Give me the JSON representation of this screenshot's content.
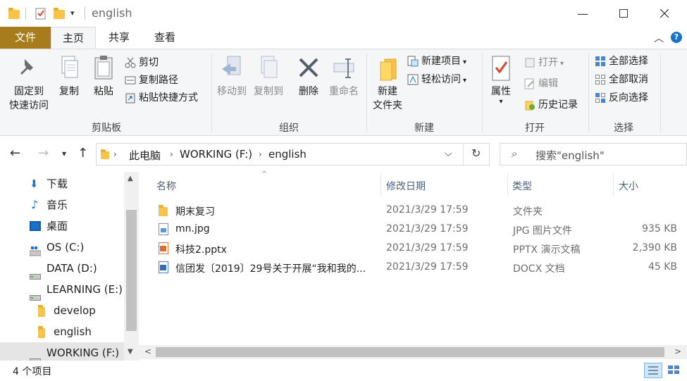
{
  "window": {
    "title": "english"
  },
  "tabs": {
    "file": "文件",
    "home": "主页",
    "share": "共享",
    "view": "查看"
  },
  "ribbon": {
    "clipboard": {
      "label": "剪贴板",
      "pin_line1": "固定到",
      "pin_line2": "快速访问",
      "copy": "复制",
      "paste": "粘贴",
      "cut": "剪切",
      "copy_path": "复制路径",
      "paste_shortcut": "粘贴快捷方式"
    },
    "organize": {
      "label": "组织",
      "move_to": "移动到",
      "copy_to": "复制到",
      "delete": "删除",
      "rename": "重命名"
    },
    "new": {
      "label": "新建",
      "new_folder_line1": "新建",
      "new_folder_line2": "文件夹",
      "new_item": "新建项目",
      "easy_access": "轻松访问"
    },
    "open": {
      "label": "打开",
      "properties": "属性",
      "open": "打开",
      "edit": "编辑",
      "history": "历史记录"
    },
    "select": {
      "label": "选择",
      "select_all": "全部选择",
      "select_none": "全部取消",
      "invert": "反向选择"
    }
  },
  "address": {
    "crumbs": [
      "此电脑",
      "WORKING (F:)",
      "english"
    ],
    "search_placeholder": "搜索\"english\""
  },
  "nav": {
    "items": [
      {
        "label": "下载",
        "icon": "download-icon"
      },
      {
        "label": "音乐",
        "icon": "music-icon"
      },
      {
        "label": "桌面",
        "icon": "desktop-icon"
      },
      {
        "label": "OS (C:)",
        "icon": "windows-drive-icon"
      },
      {
        "label": "DATA (D:)",
        "icon": "drive-icon"
      },
      {
        "label": "LEARNING (E:)",
        "icon": "drive-icon"
      },
      {
        "label": "develop",
        "icon": "folder-icon"
      },
      {
        "label": "english",
        "icon": "folder-icon"
      },
      {
        "label": "WORKING (F:)",
        "icon": "drive-icon"
      }
    ]
  },
  "columns": {
    "name": "名称",
    "modified": "修改日期",
    "type": "类型",
    "size": "大小"
  },
  "files": [
    {
      "name": "期末复习",
      "modified": "2021/3/29 17:59",
      "type": "文件夹",
      "size": "",
      "icon": "folder-icon"
    },
    {
      "name": "mn.jpg",
      "modified": "2021/3/29 17:59",
      "type": "JPG 图片文件",
      "size": "935 KB",
      "icon": "image-file-icon"
    },
    {
      "name": "科技2.pptx",
      "modified": "2021/3/29 17:59",
      "type": "PPTX 演示文稿",
      "size": "2,390 KB",
      "icon": "pptx-file-icon"
    },
    {
      "name": "信团发〔2019〕29号关于开展“我和我的...",
      "modified": "2021/3/29 17:59",
      "type": "DOCX 文档",
      "size": "45 KB",
      "icon": "docx-file-icon"
    }
  ],
  "status": {
    "count": "4 个项目"
  },
  "colors": {
    "file_tab": "#a67c1c",
    "folder": "#f6c44a",
    "selected_nav": "#cce8ff"
  }
}
